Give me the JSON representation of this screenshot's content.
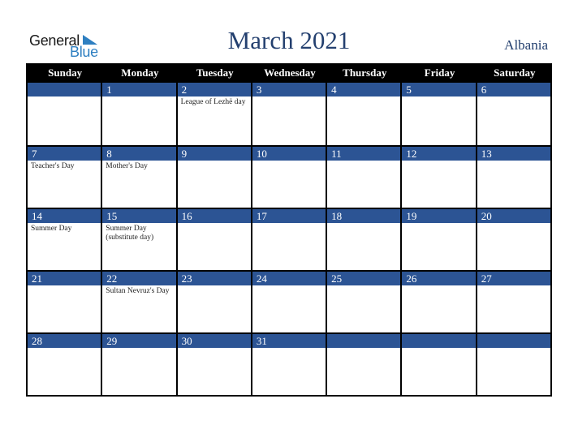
{
  "logo": {
    "word1": "General",
    "word2": "Blue"
  },
  "title": "March 2021",
  "country": "Albania",
  "colors": {
    "band": "#2c5494",
    "title": "#24406f",
    "header_bg": "#000000"
  },
  "weekdays": [
    "Sunday",
    "Monday",
    "Tuesday",
    "Wednesday",
    "Thursday",
    "Friday",
    "Saturday"
  ],
  "weeks": [
    [
      {
        "day": "",
        "event": ""
      },
      {
        "day": "1",
        "event": ""
      },
      {
        "day": "2",
        "event": "League of Lezhë day"
      },
      {
        "day": "3",
        "event": ""
      },
      {
        "day": "4",
        "event": ""
      },
      {
        "day": "5",
        "event": ""
      },
      {
        "day": "6",
        "event": ""
      }
    ],
    [
      {
        "day": "7",
        "event": "Teacher's Day"
      },
      {
        "day": "8",
        "event": "Mother's Day"
      },
      {
        "day": "9",
        "event": ""
      },
      {
        "day": "10",
        "event": ""
      },
      {
        "day": "11",
        "event": ""
      },
      {
        "day": "12",
        "event": ""
      },
      {
        "day": "13",
        "event": ""
      }
    ],
    [
      {
        "day": "14",
        "event": "Summer Day"
      },
      {
        "day": "15",
        "event": "Summer Day (substitute day)"
      },
      {
        "day": "16",
        "event": ""
      },
      {
        "day": "17",
        "event": ""
      },
      {
        "day": "18",
        "event": ""
      },
      {
        "day": "19",
        "event": ""
      },
      {
        "day": "20",
        "event": ""
      }
    ],
    [
      {
        "day": "21",
        "event": ""
      },
      {
        "day": "22",
        "event": "Sultan Nevruz's Day"
      },
      {
        "day": "23",
        "event": ""
      },
      {
        "day": "24",
        "event": ""
      },
      {
        "day": "25",
        "event": ""
      },
      {
        "day": "26",
        "event": ""
      },
      {
        "day": "27",
        "event": ""
      }
    ],
    [
      {
        "day": "28",
        "event": ""
      },
      {
        "day": "29",
        "event": ""
      },
      {
        "day": "30",
        "event": ""
      },
      {
        "day": "31",
        "event": ""
      },
      {
        "day": "",
        "event": ""
      },
      {
        "day": "",
        "event": ""
      },
      {
        "day": "",
        "event": ""
      }
    ]
  ]
}
